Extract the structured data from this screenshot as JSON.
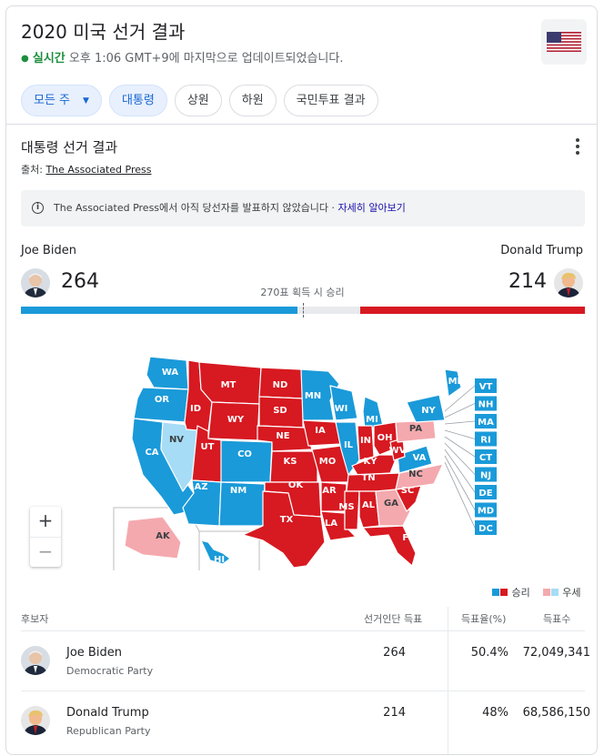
{
  "header": {
    "title": "2020 미국 선거 결과",
    "live_label": "실시간",
    "updated": "오후 1:06 GMT+9에 마지막으로 업데이트되었습니다."
  },
  "chips": [
    {
      "label": "모든 주",
      "selected": true
    },
    {
      "label": "대통령",
      "selected": true
    },
    {
      "label": "상원",
      "selected": false
    },
    {
      "label": "하원",
      "selected": false
    },
    {
      "label": "국민투표 결과",
      "selected": false
    }
  ],
  "section": {
    "title": "대통령 선거 결과",
    "source_prefix": "출처:",
    "source_name": "The Associated Press"
  },
  "notice": {
    "text": "The Associated Press에서 아직 당선자를 발표하지 않았습니다 · ",
    "link": "자세히 알아보기"
  },
  "race": {
    "threshold_label": "270표 획득 시 승리",
    "total_electoral": 538,
    "biden": {
      "name": "Joe Biden",
      "votes": "264",
      "electoral": 264
    },
    "trump": {
      "name": "Donald Trump",
      "votes": "214",
      "electoral": 214
    }
  },
  "colors": {
    "dem_win": "#1a9ad9",
    "rep_win": "#d71921",
    "dem_lead": "#a6dcf5",
    "rep_lead": "#f4a9ae",
    "uncalled": "#e8eaed"
  },
  "map": {
    "states": {
      "WA": "dem_win",
      "OR": "dem_win",
      "CA": "dem_win",
      "NV": "dem_lead",
      "ID": "rep_win",
      "MT": "rep_win",
      "WY": "rep_win",
      "UT": "rep_win",
      "AZ": "dem_win",
      "CO": "dem_win",
      "NM": "dem_win",
      "ND": "rep_win",
      "SD": "rep_win",
      "NE": "rep_win",
      "KS": "rep_win",
      "OK": "rep_win",
      "TX": "rep_win",
      "MN": "dem_win",
      "IA": "rep_win",
      "MO": "rep_win",
      "AR": "rep_win",
      "LA": "rep_win",
      "WI": "dem_win",
      "IL": "dem_win",
      "MI": "dem_win",
      "IN": "rep_win",
      "OH": "rep_win",
      "KY": "rep_win",
      "TN": "rep_win",
      "MS": "rep_win",
      "AL": "rep_win",
      "GA": "rep_lead",
      "FL": "rep_win",
      "SC": "rep_win",
      "NC": "rep_lead",
      "VA": "dem_win",
      "WV": "rep_win",
      "PA": "rep_lead",
      "NY": "dem_win",
      "ME": "dem_win",
      "AK": "rep_lead",
      "HI": "dem_win"
    },
    "small_states": [
      "VT",
      "NH",
      "MA",
      "RI",
      "CT",
      "NJ",
      "DE",
      "MD",
      "DC"
    ],
    "zoom_in": "+",
    "zoom_out": "−"
  },
  "legend": {
    "win": "승리",
    "lead": "우세"
  },
  "table": {
    "headers": {
      "candidate": "후보자",
      "electoral": "선거인단 득표",
      "percent": "득표율(%)",
      "votes": "득표수"
    },
    "rows": [
      {
        "name": "Joe Biden",
        "party": "Democratic Party",
        "electoral": "264",
        "percent": "50.4%",
        "votes": "72,049,341"
      },
      {
        "name": "Donald Trump",
        "party": "Republican Party",
        "electoral": "214",
        "percent": "48%",
        "votes": "68,586,150"
      }
    ]
  }
}
